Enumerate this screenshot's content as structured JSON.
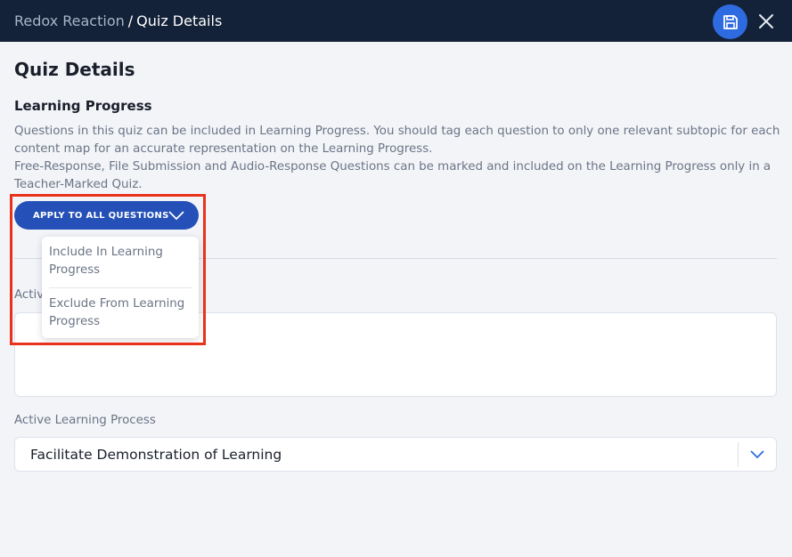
{
  "header": {
    "breadcrumb_parent": "Redox Reaction",
    "breadcrumb_separator": "/",
    "breadcrumb_current": "Quiz Details",
    "save_icon": "save-icon",
    "close_icon": "close-icon",
    "save_button_color": "#2f6be0",
    "background_color": "#132238"
  },
  "main": {
    "page_title": "Quiz Details",
    "section_title": "Learning Progress",
    "description_line1": "Questions in this quiz can be included in Learning Progress. You should tag each question to only one relevant subtopic for each content map for an accurate representation on the Learning Progress.",
    "description_line2": "Free-Response, File Submission and Audio-Response Questions can be marked and included on the Learning Progress only in a Teacher-Marked Quiz.",
    "apply_button_label": "APPLY TO ALL QUESTIONS",
    "apply_button_color": "#2450b8",
    "dropdown_options": [
      "Include In Learning Progress",
      "Exclude From Learning Progress"
    ],
    "field1_label_visible": "Activ",
    "field1_value": "",
    "field2_label": "Active Learning Process",
    "field2_value": "Facilitate Demonstration of Learning",
    "highlight_color": "#e8321c"
  }
}
